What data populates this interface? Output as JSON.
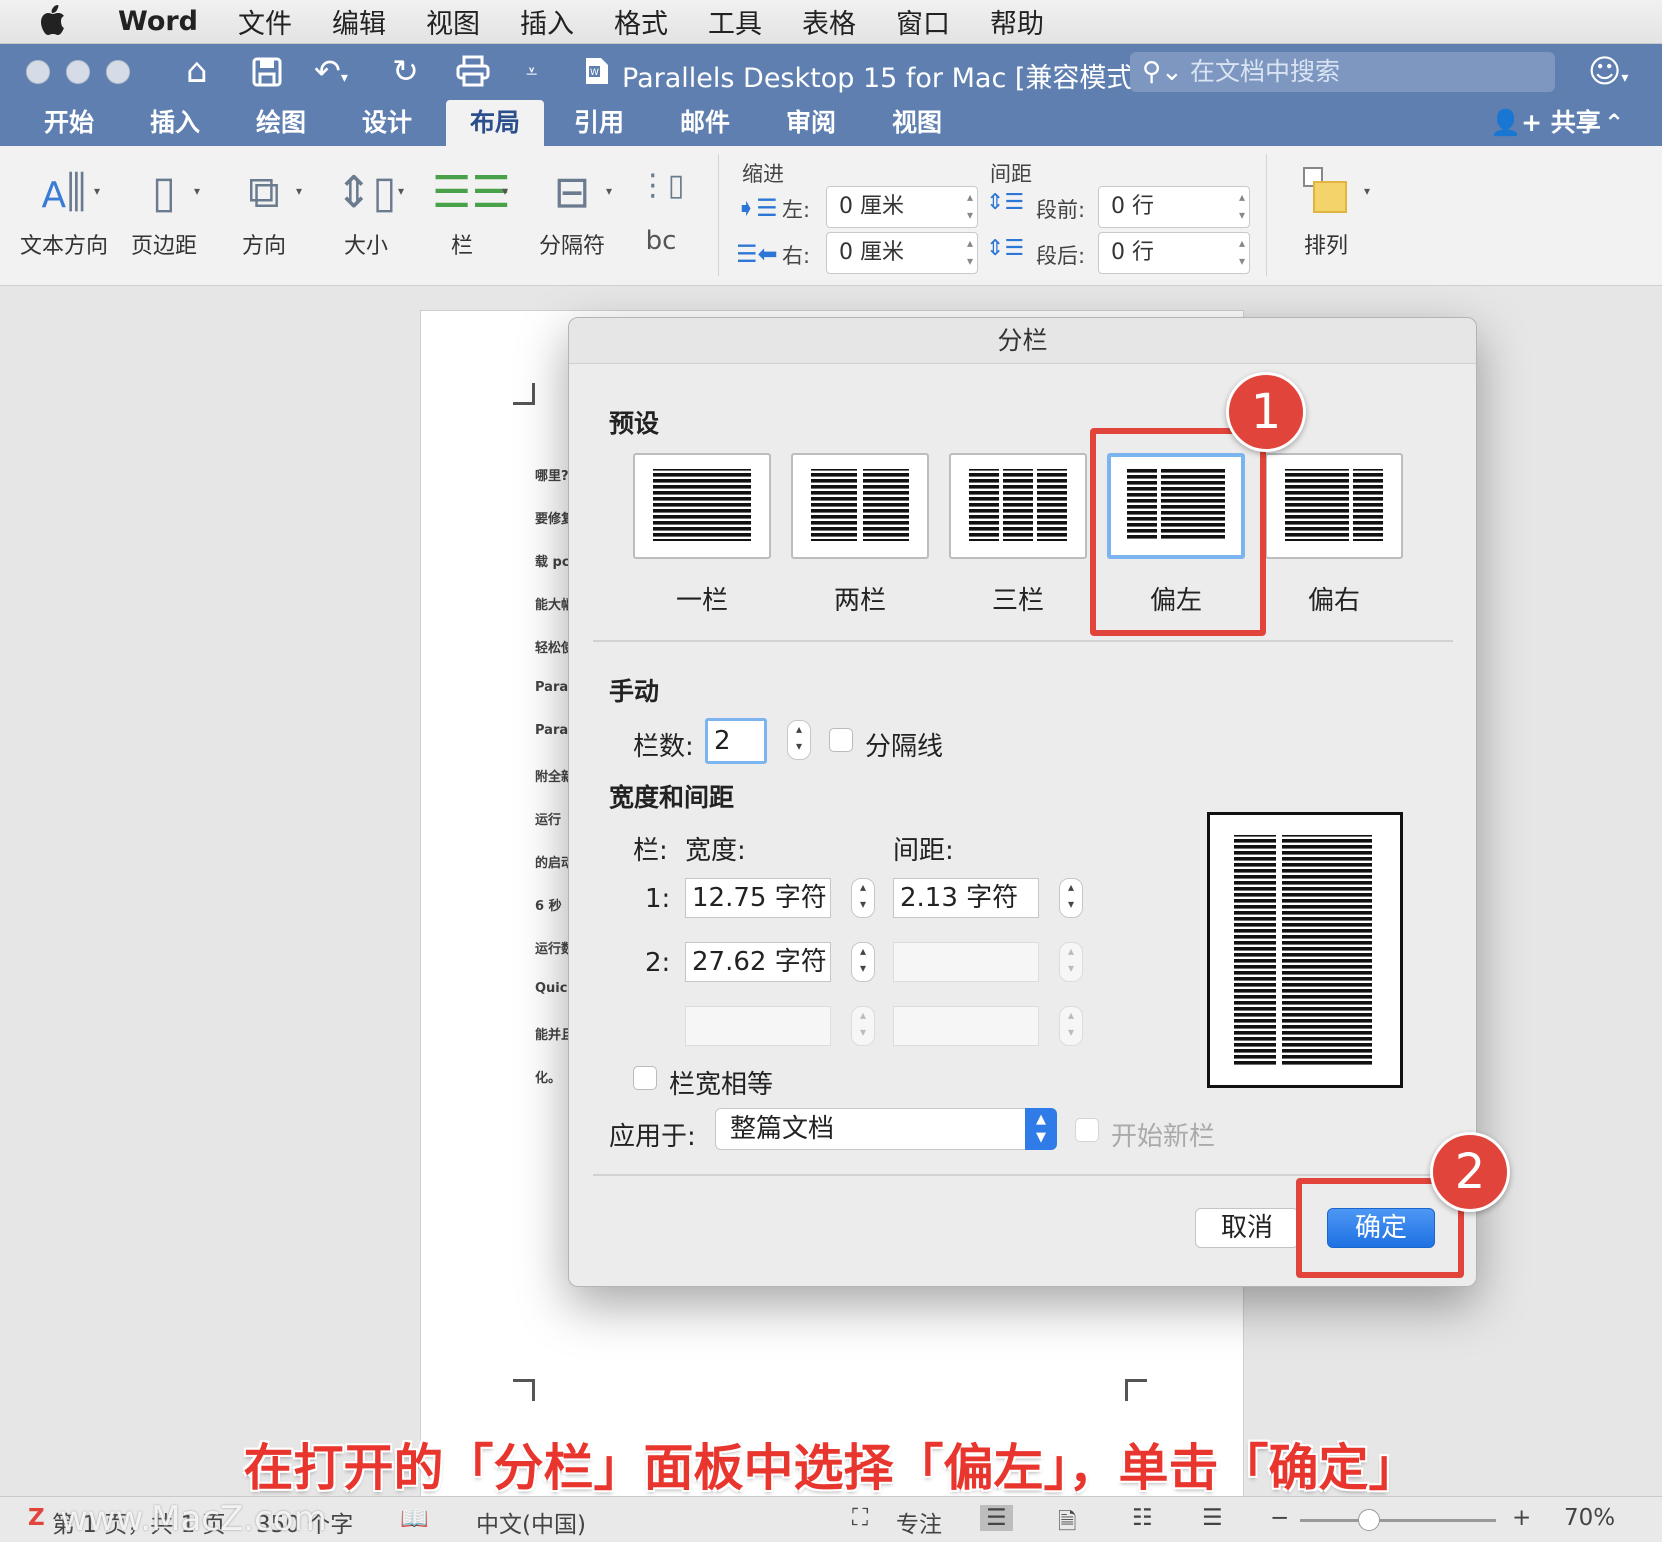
{
  "menubar": {
    "app": "Word",
    "items": [
      "文件",
      "编辑",
      "视图",
      "插入",
      "格式",
      "工具",
      "表格",
      "窗口",
      "帮助"
    ]
  },
  "window": {
    "title": "Parallels Desktop 15 for Mac [兼容模式]",
    "search_placeholder": "在文档中搜索"
  },
  "tabs": [
    "开始",
    "插入",
    "绘图",
    "设计",
    "布局",
    "引用",
    "邮件",
    "审阅",
    "视图"
  ],
  "active_tab": "布局",
  "share_label": "共享",
  "ribbon": {
    "buttons": [
      "文本方向",
      "页边距",
      "方向",
      "大小",
      "栏",
      "分隔符",
      "排列"
    ],
    "hyphen_label": "bc",
    "indent": {
      "header": "缩进",
      "left_label": "左:",
      "left_value": "0 厘米",
      "right_label": "右:",
      "right_value": "0 厘米"
    },
    "spacing": {
      "header": "间距",
      "before_label": "段前:",
      "before_value": "0 行",
      "after_label": "段后:",
      "after_value": "0 行"
    }
  },
  "document": {
    "line_starts": [
      "哪里?",
      "要修复",
      "载 pc",
      "能大幅",
      "轻松使",
      "Parall",
      "Parall",
      "附全新",
      "运行",
      "的启动",
      "6 秒",
      "运行数",
      "Quick",
      "能并且",
      "化。"
    ]
  },
  "dialog": {
    "title": "分栏",
    "presets_header": "预设",
    "presets": [
      "一栏",
      "两栏",
      "三栏",
      "偏左",
      "偏右"
    ],
    "selected_preset": "偏左",
    "manual_header": "手动",
    "columns_label": "栏数:",
    "columns_value": "2",
    "line_between_label": "分隔线",
    "width_spacing_header": "宽度和间距",
    "col_header": "栏:",
    "width_header": "宽度:",
    "spacing_header": "间距:",
    "rows": [
      {
        "num": "1:",
        "width": "12.75 字符",
        "spacing": "2.13 字符"
      },
      {
        "num": "2:",
        "width": "27.62 字符",
        "spacing": ""
      },
      {
        "num": "",
        "width": "",
        "spacing": ""
      }
    ],
    "equal_width_label": "栏宽相等",
    "apply_label": "应用于:",
    "apply_value": "整篇文档",
    "new_column_label": "开始新栏",
    "cancel_label": "取消",
    "ok_label": "确定"
  },
  "annotations": {
    "badge1": "1",
    "badge2": "2",
    "caption": "在打开的「分栏」面板中选择「偏左」，单击「确定」",
    "accent": "#e0443a"
  },
  "statusbar": {
    "page_info": "第 1 页，共 1 页",
    "word_count": "350 个字",
    "watermark": "www.MacZ.com",
    "language": "中文(中国)",
    "focus": "专注",
    "zoom": "70%"
  }
}
